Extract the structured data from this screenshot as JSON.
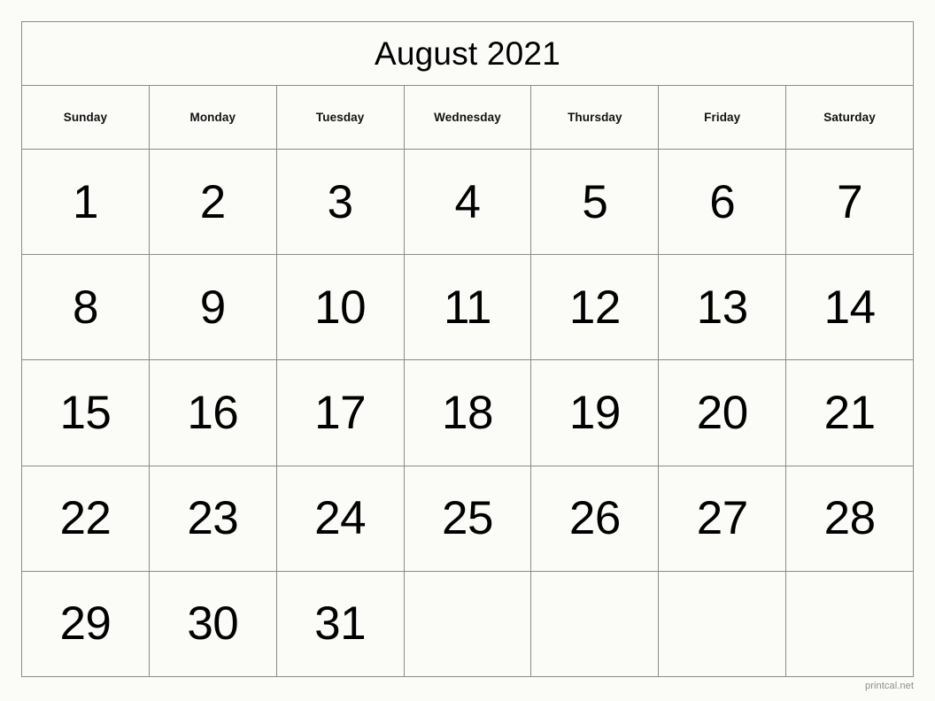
{
  "calendar": {
    "title": "August 2021",
    "month": "August",
    "year": "2021",
    "weekday_headers": [
      "Sunday",
      "Monday",
      "Tuesday",
      "Wednesday",
      "Thursday",
      "Friday",
      "Saturday"
    ],
    "weeks": [
      [
        "1",
        "2",
        "3",
        "4",
        "5",
        "6",
        "7"
      ],
      [
        "8",
        "9",
        "10",
        "11",
        "12",
        "13",
        "14"
      ],
      [
        "15",
        "16",
        "17",
        "18",
        "19",
        "20",
        "21"
      ],
      [
        "22",
        "23",
        "24",
        "25",
        "26",
        "27",
        "28"
      ],
      [
        "29",
        "30",
        "31",
        "",
        "",
        "",
        ""
      ]
    ]
  },
  "footer": {
    "attribution": "printcal.net"
  },
  "colors": {
    "background": "#fbfcf8",
    "border": "#8a8a8a",
    "text": "#000000",
    "footer_text": "#8c8c8c"
  }
}
